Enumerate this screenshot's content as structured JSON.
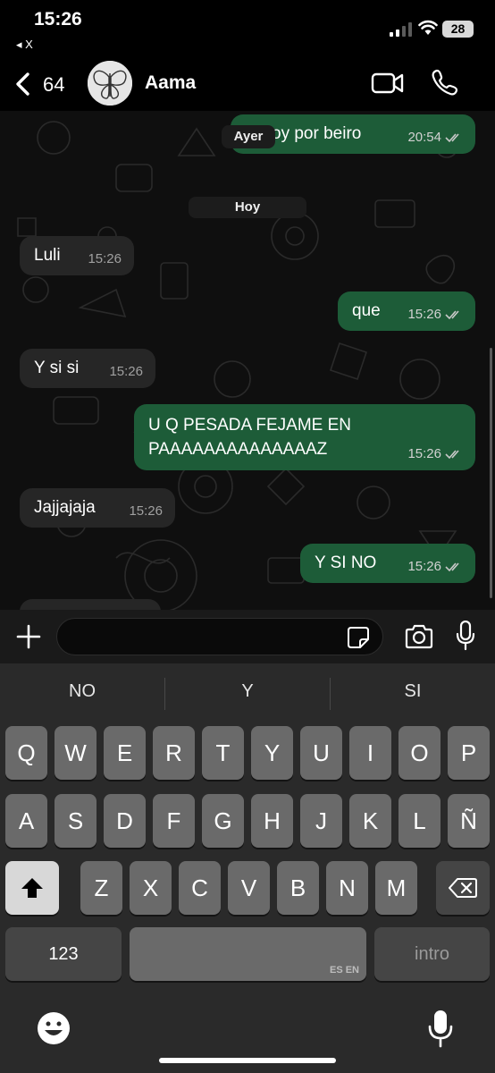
{
  "status_bar": {
    "time": "15:26",
    "back_app": "◂ X",
    "battery": "28"
  },
  "header": {
    "back_count": "64",
    "contact_name": "Aama"
  },
  "chat": {
    "day_labels": {
      "yesterday": "Ayer",
      "today": "Hoy"
    },
    "partial_message": {
      "text": "oy por beiro",
      "time": "20:54"
    },
    "messages": [
      {
        "direction": "in",
        "text": "Luli",
        "time": "15:26"
      },
      {
        "direction": "out",
        "text": "que",
        "time": "15:26"
      },
      {
        "direction": "in",
        "text": "Y si si",
        "time": "15:26"
      },
      {
        "direction": "out",
        "text": "U Q PESADA FEJAME EN\nPAAAAAAAAAAAAAAZ",
        "time": "15:26"
      },
      {
        "direction": "in",
        "text": "Jajjajaja",
        "time": "15:26"
      },
      {
        "direction": "out",
        "text": "Y SI NO",
        "time": "15:26"
      }
    ],
    "colors": {
      "incoming": "#262626",
      "outgoing": "#1d5c38"
    }
  },
  "input": {
    "value": ""
  },
  "keyboard": {
    "suggestions": [
      "NO",
      "Y",
      "SI"
    ],
    "row1": [
      "Q",
      "W",
      "E",
      "R",
      "T",
      "Y",
      "U",
      "I",
      "O",
      "P"
    ],
    "row2": [
      "A",
      "S",
      "D",
      "F",
      "G",
      "H",
      "J",
      "K",
      "L",
      "Ñ"
    ],
    "row3": [
      "Z",
      "X",
      "C",
      "V",
      "B",
      "N",
      "M"
    ],
    "numbers_label": "123",
    "space_lang": "ES EN",
    "return_label": "intro"
  }
}
